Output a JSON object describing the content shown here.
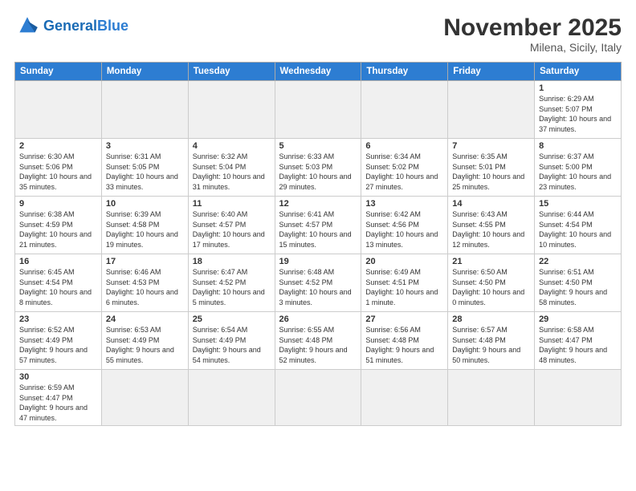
{
  "logo": {
    "text_general": "General",
    "text_blue": "Blue"
  },
  "header": {
    "month_year": "November 2025",
    "location": "Milena, Sicily, Italy"
  },
  "weekdays": [
    "Sunday",
    "Monday",
    "Tuesday",
    "Wednesday",
    "Thursday",
    "Friday",
    "Saturday"
  ],
  "weeks": [
    [
      {
        "day": "",
        "info": "",
        "empty": true
      },
      {
        "day": "",
        "info": "",
        "empty": true
      },
      {
        "day": "",
        "info": "",
        "empty": true
      },
      {
        "day": "",
        "info": "",
        "empty": true
      },
      {
        "day": "",
        "info": "",
        "empty": true
      },
      {
        "day": "",
        "info": "",
        "empty": true
      },
      {
        "day": "1",
        "info": "Sunrise: 6:29 AM\nSunset: 5:07 PM\nDaylight: 10 hours\nand 37 minutes."
      }
    ],
    [
      {
        "day": "2",
        "info": "Sunrise: 6:30 AM\nSunset: 5:06 PM\nDaylight: 10 hours\nand 35 minutes."
      },
      {
        "day": "3",
        "info": "Sunrise: 6:31 AM\nSunset: 5:05 PM\nDaylight: 10 hours\nand 33 minutes."
      },
      {
        "day": "4",
        "info": "Sunrise: 6:32 AM\nSunset: 5:04 PM\nDaylight: 10 hours\nand 31 minutes."
      },
      {
        "day": "5",
        "info": "Sunrise: 6:33 AM\nSunset: 5:03 PM\nDaylight: 10 hours\nand 29 minutes."
      },
      {
        "day": "6",
        "info": "Sunrise: 6:34 AM\nSunset: 5:02 PM\nDaylight: 10 hours\nand 27 minutes."
      },
      {
        "day": "7",
        "info": "Sunrise: 6:35 AM\nSunset: 5:01 PM\nDaylight: 10 hours\nand 25 minutes."
      },
      {
        "day": "8",
        "info": "Sunrise: 6:37 AM\nSunset: 5:00 PM\nDaylight: 10 hours\nand 23 minutes."
      }
    ],
    [
      {
        "day": "9",
        "info": "Sunrise: 6:38 AM\nSunset: 4:59 PM\nDaylight: 10 hours\nand 21 minutes."
      },
      {
        "day": "10",
        "info": "Sunrise: 6:39 AM\nSunset: 4:58 PM\nDaylight: 10 hours\nand 19 minutes."
      },
      {
        "day": "11",
        "info": "Sunrise: 6:40 AM\nSunset: 4:57 PM\nDaylight: 10 hours\nand 17 minutes."
      },
      {
        "day": "12",
        "info": "Sunrise: 6:41 AM\nSunset: 4:57 PM\nDaylight: 10 hours\nand 15 minutes."
      },
      {
        "day": "13",
        "info": "Sunrise: 6:42 AM\nSunset: 4:56 PM\nDaylight: 10 hours\nand 13 minutes."
      },
      {
        "day": "14",
        "info": "Sunrise: 6:43 AM\nSunset: 4:55 PM\nDaylight: 10 hours\nand 12 minutes."
      },
      {
        "day": "15",
        "info": "Sunrise: 6:44 AM\nSunset: 4:54 PM\nDaylight: 10 hours\nand 10 minutes."
      }
    ],
    [
      {
        "day": "16",
        "info": "Sunrise: 6:45 AM\nSunset: 4:54 PM\nDaylight: 10 hours\nand 8 minutes."
      },
      {
        "day": "17",
        "info": "Sunrise: 6:46 AM\nSunset: 4:53 PM\nDaylight: 10 hours\nand 6 minutes."
      },
      {
        "day": "18",
        "info": "Sunrise: 6:47 AM\nSunset: 4:52 PM\nDaylight: 10 hours\nand 5 minutes."
      },
      {
        "day": "19",
        "info": "Sunrise: 6:48 AM\nSunset: 4:52 PM\nDaylight: 10 hours\nand 3 minutes."
      },
      {
        "day": "20",
        "info": "Sunrise: 6:49 AM\nSunset: 4:51 PM\nDaylight: 10 hours\nand 1 minute."
      },
      {
        "day": "21",
        "info": "Sunrise: 6:50 AM\nSunset: 4:50 PM\nDaylight: 10 hours\nand 0 minutes."
      },
      {
        "day": "22",
        "info": "Sunrise: 6:51 AM\nSunset: 4:50 PM\nDaylight: 9 hours\nand 58 minutes."
      }
    ],
    [
      {
        "day": "23",
        "info": "Sunrise: 6:52 AM\nSunset: 4:49 PM\nDaylight: 9 hours\nand 57 minutes."
      },
      {
        "day": "24",
        "info": "Sunrise: 6:53 AM\nSunset: 4:49 PM\nDaylight: 9 hours\nand 55 minutes."
      },
      {
        "day": "25",
        "info": "Sunrise: 6:54 AM\nSunset: 4:49 PM\nDaylight: 9 hours\nand 54 minutes."
      },
      {
        "day": "26",
        "info": "Sunrise: 6:55 AM\nSunset: 4:48 PM\nDaylight: 9 hours\nand 52 minutes."
      },
      {
        "day": "27",
        "info": "Sunrise: 6:56 AM\nSunset: 4:48 PM\nDaylight: 9 hours\nand 51 minutes."
      },
      {
        "day": "28",
        "info": "Sunrise: 6:57 AM\nSunset: 4:48 PM\nDaylight: 9 hours\nand 50 minutes."
      },
      {
        "day": "29",
        "info": "Sunrise: 6:58 AM\nSunset: 4:47 PM\nDaylight: 9 hours\nand 48 minutes."
      }
    ],
    [
      {
        "day": "30",
        "info": "Sunrise: 6:59 AM\nSunset: 4:47 PM\nDaylight: 9 hours\nand 47 minutes."
      },
      {
        "day": "",
        "info": "",
        "empty": true
      },
      {
        "day": "",
        "info": "",
        "empty": true
      },
      {
        "day": "",
        "info": "",
        "empty": true
      },
      {
        "day": "",
        "info": "",
        "empty": true
      },
      {
        "day": "",
        "info": "",
        "empty": true
      },
      {
        "day": "",
        "info": "",
        "empty": true
      }
    ]
  ]
}
